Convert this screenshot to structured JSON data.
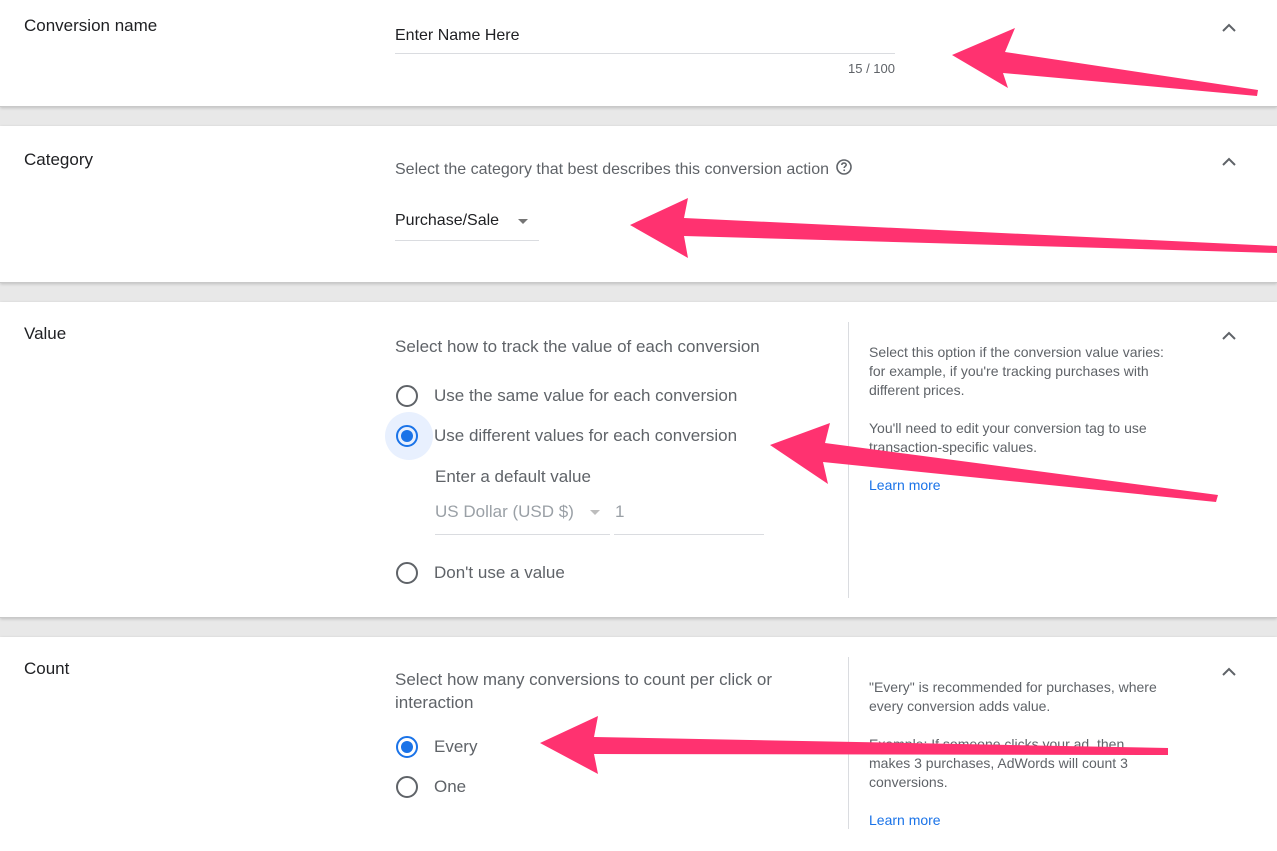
{
  "conversion_name": {
    "title": "Conversion name",
    "value": "Enter Name Here",
    "char_count": "15 / 100"
  },
  "category": {
    "title": "Category",
    "prompt": "Select the category that best describes this conversion action",
    "help_icon": "help-circle-icon",
    "selected": "Purchase/Sale"
  },
  "value": {
    "title": "Value",
    "prompt": "Select how to track the value of each conversion",
    "options": [
      {
        "label": "Use the same value for each conversion",
        "checked": false
      },
      {
        "label": "Use different values for each conversion",
        "checked": true
      },
      {
        "label": "Don't use a value",
        "checked": false
      }
    ],
    "default_value_label": "Enter a default value",
    "currency": "US Dollar (USD $)",
    "amount": "1",
    "help_1": "Select this option if the conversion value varies: for example, if you're tracking purchases with different prices.",
    "help_2": "You'll need to edit your conversion tag to use transaction-specific values.",
    "learn_more": "Learn more"
  },
  "count": {
    "title": "Count",
    "prompt": "Select how many conversions to count per click or interaction",
    "options": [
      {
        "label": "Every",
        "checked": true
      },
      {
        "label": "One",
        "checked": false
      }
    ],
    "help_1": "\"Every\" is recommended for purchases, where every conversion adds value.",
    "help_2": "Example: If someone clicks your ad, then makes 3 purchases, AdWords will count 3 conversions.",
    "learn_more": "Learn more"
  },
  "colors": {
    "accent": "#1a73e8",
    "annotation_arrow": "#ff3270",
    "muted_text": "#5f6368"
  },
  "icons": {
    "collapse": "chevron-up-icon",
    "dropdown": "caret-down-icon"
  }
}
